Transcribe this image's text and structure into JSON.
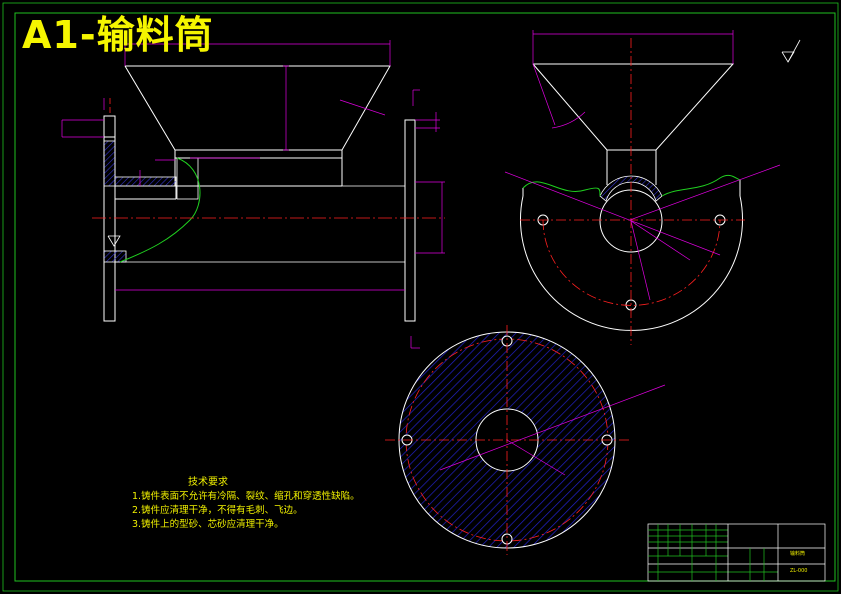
{
  "drawing": {
    "title": "A1-输料筒",
    "colors": {
      "background": "#000000",
      "outline": "#ffffff",
      "dimension": "#e000e0",
      "centerline": "#ff2020",
      "hatch": "#2020c0",
      "breakline": "#20d020",
      "frame": "#20c020",
      "text": "#f0f000"
    }
  },
  "tech": {
    "heading": "技术要求",
    "items": [
      "1.铸件表面不允许有冷隔、裂纹、缩孔和穿透性缺陷。",
      "2.铸件应清理干净，不得有毛刺、飞边。",
      "3.铸件上的型砂、芯砂应清理干净。"
    ]
  },
  "titleblock": {
    "part_name": "输料筒",
    "drawing_no": "ZL-000"
  }
}
